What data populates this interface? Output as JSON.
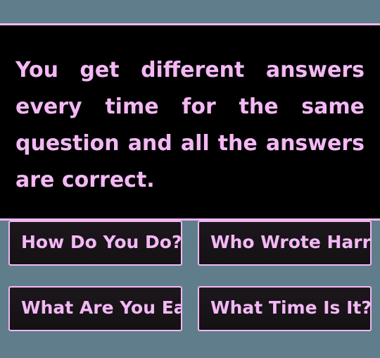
{
  "question": {
    "text": "You get different answers every time for the same question and all the answers are correct."
  },
  "answers": [
    {
      "label": "How Do You Do?"
    },
    {
      "label": "Who Wrote Harry"
    },
    {
      "label": "What Are You Eating?"
    },
    {
      "label": "What Time Is It?"
    }
  ],
  "colors": {
    "background": "#607d8b",
    "panel": "#000000",
    "accent": "#f4b8f5"
  }
}
